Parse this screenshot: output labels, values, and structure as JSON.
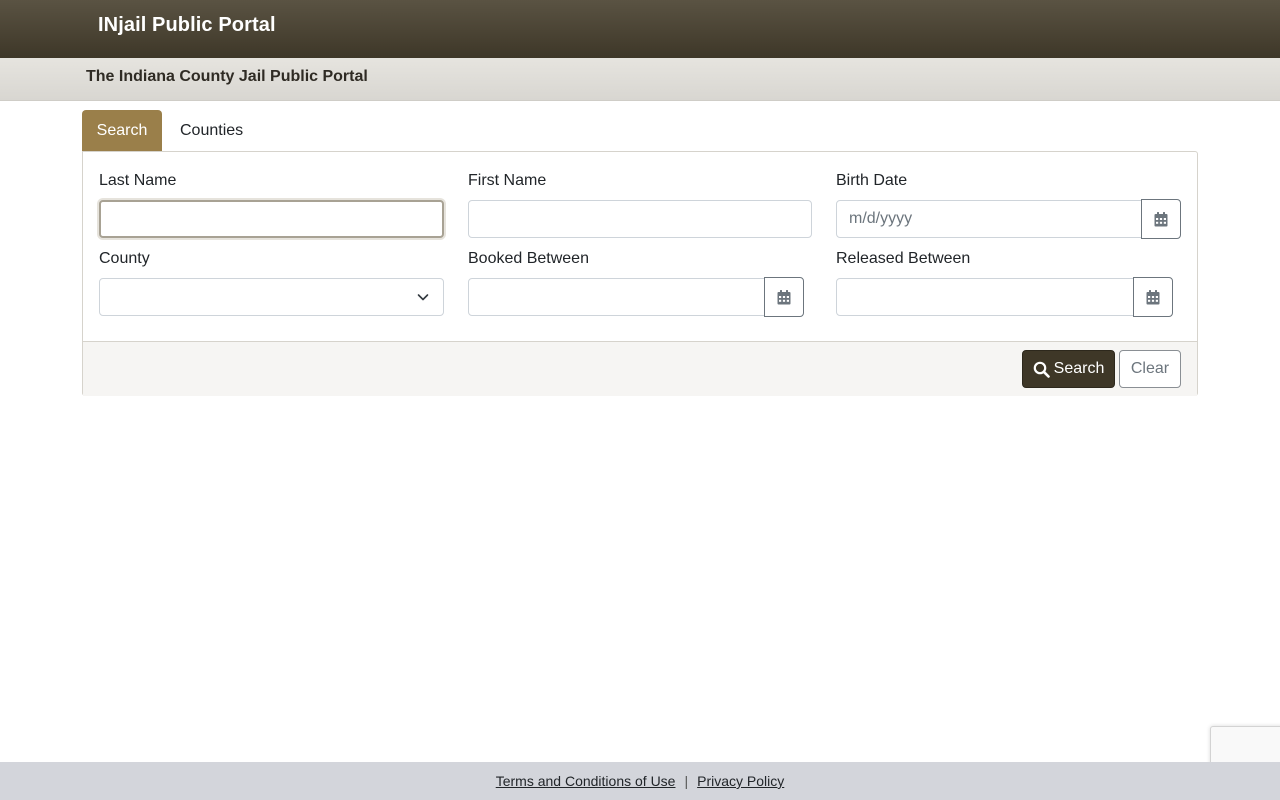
{
  "header": {
    "brand": "INjail Public Portal",
    "subtitle": "The Indiana County Jail Public Portal"
  },
  "tabs": [
    {
      "label": "Search",
      "active": true
    },
    {
      "label": "Counties",
      "active": false
    }
  ],
  "form": {
    "last_name": {
      "label": "Last Name",
      "value": "",
      "placeholder": ""
    },
    "first_name": {
      "label": "First Name",
      "value": "",
      "placeholder": ""
    },
    "birth_date": {
      "label": "Birth Date",
      "value": "",
      "placeholder": "m/d/yyyy"
    },
    "county": {
      "label": "County",
      "selected": ""
    },
    "booked_between": {
      "label": "Booked Between",
      "value": ""
    },
    "released_between": {
      "label": "Released Between",
      "value": ""
    }
  },
  "actions": {
    "search_label": "Search",
    "clear_label": "Clear"
  },
  "footer": {
    "terms": "Terms and Conditions of Use",
    "separator": "|",
    "privacy": "Privacy Policy"
  },
  "icons": {
    "calendar": "calendar-icon",
    "search": "search-icon",
    "chevron": "chevron-down-icon"
  },
  "colors": {
    "header_dark": "#3e3728",
    "tab_active": "#9a7f4a",
    "search_button": "#3e3727",
    "footer_bg": "#d3d5db"
  }
}
